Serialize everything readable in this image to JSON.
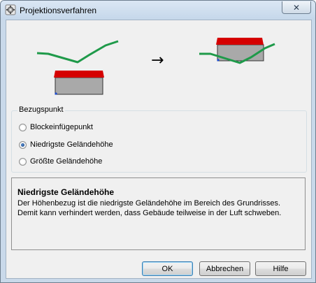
{
  "window": {
    "title": "Projektionsverfahren",
    "icons": {
      "app": "app-gear-icon",
      "close": "close-icon"
    },
    "close_glyph": "✕"
  },
  "illustration": {
    "arrow": "→"
  },
  "colors": {
    "terrain": "#1f9a4a",
    "roof": "#d50000",
    "building": "#a9a9a9",
    "anchor": "#1a4bd1"
  },
  "group": {
    "label": "Bezugspunkt",
    "options": [
      {
        "label": "Blockeinfügepunkt",
        "checked": false
      },
      {
        "label": "Niedrigste Geländehöhe",
        "checked": true
      },
      {
        "label": "Größte Geländehöhe",
        "checked": false
      }
    ]
  },
  "info": {
    "title": "Niedrigste Geländehöhe",
    "text": "Der Höhenbezug ist die niedrigste Geländehöhe im Bereich des Grundrisses. Demit kann verhindert werden, dass Gebäude teilweise in der Luft schweben."
  },
  "buttons": {
    "ok": "OK",
    "cancel": "Abbrechen",
    "help": "Hilfe"
  }
}
